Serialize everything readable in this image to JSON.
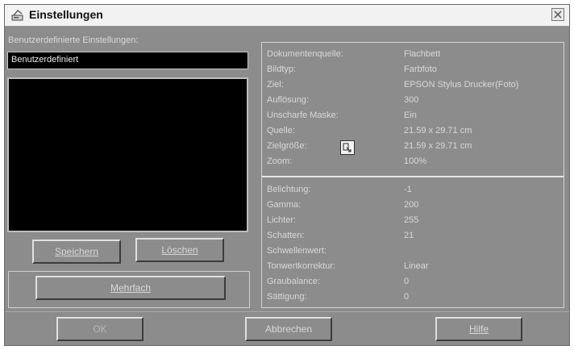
{
  "window": {
    "title": "Einstellungen"
  },
  "settings_label": "Benutzerdefinierte Einstellungen:",
  "name_field_value": "Benutzerdefiniert",
  "buttons": {
    "save": "Speichern",
    "delete": "Löschen",
    "multiple": "Mehrfach",
    "ok": "OK",
    "cancel": "Abbrechen",
    "help": "Hilfe"
  },
  "info_top": [
    {
      "label": "Dokumentenquelle:",
      "value": "Flachbett"
    },
    {
      "label": "Bildtyp:",
      "value": "Farbfoto"
    },
    {
      "label": "Ziel:",
      "value": "EPSON Stylus Drucker(Foto)"
    },
    {
      "label": "Auflösung:",
      "value": "300"
    },
    {
      "label": "Unscharfe Maske:",
      "value": "Ein"
    },
    {
      "label": "Quelle:",
      "value": "21.59 x 29.71 cm"
    },
    {
      "label": "Zielgröße:",
      "value": "21.59 x 29.71 cm"
    },
    {
      "label": "Zoom:",
      "value": "100%"
    }
  ],
  "info_bottom": [
    {
      "label": "Belichtung:",
      "value": "-1"
    },
    {
      "label": "Gamma:",
      "value": "200"
    },
    {
      "label": "Lichter:",
      "value": "255"
    },
    {
      "label": "Schatten:",
      "value": "21"
    },
    {
      "label": "Schwellenwert:",
      "value": ""
    },
    {
      "label": "Tonwertkorrektur:",
      "value": "Linear"
    },
    {
      "label": "Graubalance:",
      "value": "0"
    },
    {
      "label": "Sättigung:",
      "value": "0"
    }
  ],
  "icons": {
    "title": "scanner-icon",
    "close": "close-icon",
    "target_size": "target-size-icon"
  }
}
